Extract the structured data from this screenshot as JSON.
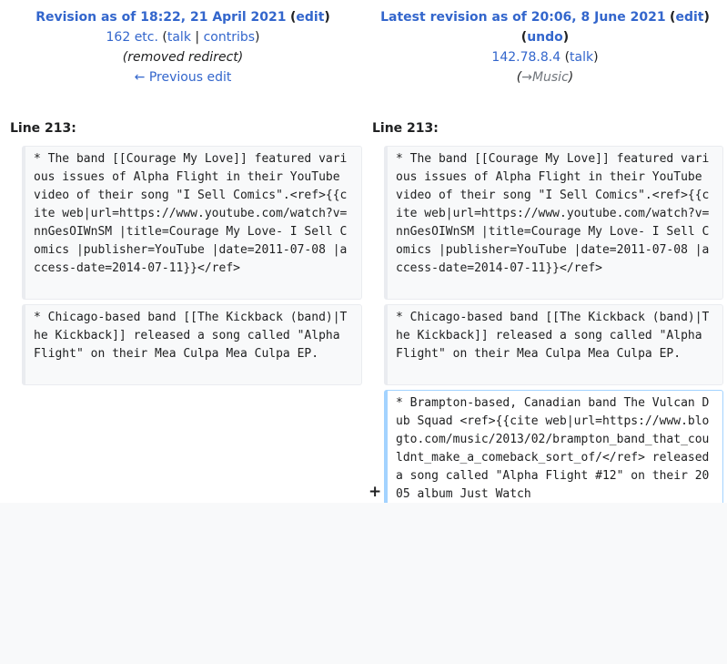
{
  "left": {
    "revision_link": "Revision as of 18:22, 21 April 2021",
    "edit_label": "edit",
    "user_link": "162 etc.",
    "talk_label": "talk",
    "separator": "|",
    "contribs_label": "contribs",
    "summary": "(removed redirect)",
    "prev_edit_label": "← Previous edit",
    "line_label": "Line 213:"
  },
  "right": {
    "revision_link": "Latest revision as of 20:06, 8 June 2021",
    "edit_label": "edit",
    "undo_label": "undo",
    "user_link": "142.78.8.4",
    "talk_label": "talk",
    "summary_prefix": "(",
    "summary_arrow": "→",
    "summary_section": "Music",
    "summary_suffix": ")",
    "line_label": "Line 213:"
  },
  "diff": {
    "context1": "* The band [[Courage My Love]] featured various issues of Alpha Flight in their YouTube video of their song \"I Sell Comics\".<ref>{{cite web|url=https://www.youtube.com/watch?v=nnGesOIWnSM |title=Courage My Love- I Sell Comics |publisher=YouTube |date=2011-07-08 |access-date=2014-07-11}}</ref>",
    "context2": "* Chicago-based band [[The Kickback (band)|The Kickback]] released a song called \"Alpha Flight\" on their Mea Culpa Mea Culpa EP.",
    "added_marker": "+",
    "added": "* Brampton-based, Canadian band The Vulcan Dub Squad <ref>{{cite web|url=https://www.blogto.com/music/2013/02/brampton_band_that_couldnt_make_a_comeback_sort_of/</ref> released a song called \"Alpha Flight #12\" on their 2005 album Just Watch"
  }
}
